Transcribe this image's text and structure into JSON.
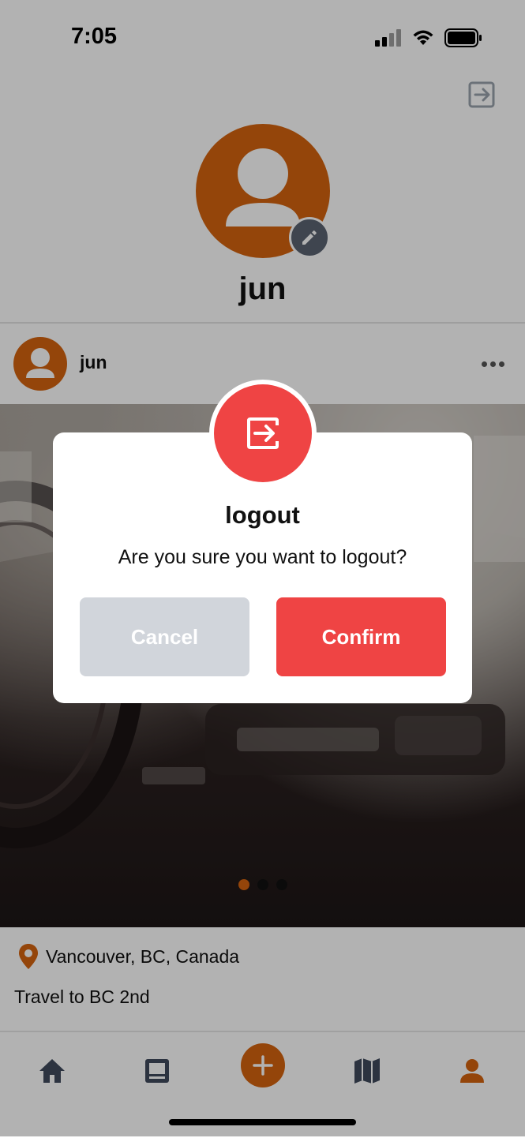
{
  "status_bar": {
    "time": "7:05"
  },
  "profile": {
    "name": "jun"
  },
  "post": {
    "username": "jun",
    "location": "Vancouver, BC, Canada",
    "caption": "Travel to BC 2nd",
    "photo_pages": 3,
    "active_page": 1
  },
  "dialog": {
    "title": "logout",
    "message": "Are you sure you want to logout?",
    "cancel_label": "Cancel",
    "confirm_label": "Confirm"
  },
  "nav": {
    "items": [
      "home-icon",
      "feed-icon",
      "add-icon",
      "map-icon",
      "profile-icon"
    ],
    "active": "profile-icon"
  },
  "colors": {
    "accent": "#d4630f",
    "danger": "#ef4444",
    "cancel_bg": "#d1d5db",
    "nav_inactive": "#3f4a5c"
  },
  "icons": {
    "top_right": "logout-icon",
    "avatar_edit": "pencil-icon",
    "post_menu": "more-horizontal-icon",
    "location": "map-pin-icon",
    "dialog": "logout-icon"
  }
}
